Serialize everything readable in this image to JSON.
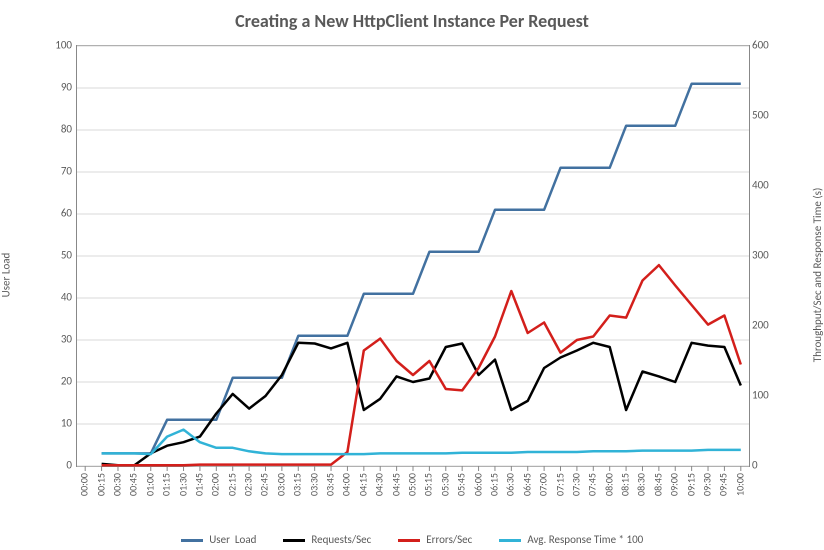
{
  "chart_data": {
    "type": "line",
    "title": "Creating a New HttpClient Instance Per Request",
    "xlabel": "",
    "ylabel_left": "User Load",
    "ylabel_right": "Throughput/Sec and Response Time (s)",
    "ylim_left": [
      0,
      100
    ],
    "ylim_right": [
      0,
      600
    ],
    "yticks_left": [
      0,
      10,
      20,
      30,
      40,
      50,
      60,
      70,
      80,
      90,
      100
    ],
    "yticks_right": [
      0,
      100,
      200,
      300,
      400,
      500,
      600
    ],
    "categories": [
      "00:00",
      "00:15",
      "00:30",
      "00:45",
      "01:00",
      "01:15",
      "01:30",
      "01:45",
      "02:00",
      "02:15",
      "02:30",
      "02:45",
      "03:00",
      "03:15",
      "03:30",
      "03:45",
      "04:00",
      "04:15",
      "04:30",
      "04:45",
      "05:00",
      "05:15",
      "05:30",
      "05:45",
      "06:00",
      "06:15",
      "06:30",
      "06:45",
      "07:00",
      "07:15",
      "07:30",
      "07:45",
      "08:00",
      "08:15",
      "08:30",
      "08:45",
      "09:00",
      "09:15",
      "09:30",
      "09:45",
      "10:00"
    ],
    "series": [
      {
        "name": "User  Load",
        "axis": "left",
        "color": "#4271A0",
        "values": [
          null,
          3,
          3,
          3,
          3,
          11,
          11,
          11,
          11,
          21,
          21,
          21,
          21,
          31,
          31,
          31,
          31,
          41,
          41,
          41,
          41,
          51,
          51,
          51,
          51,
          61,
          61,
          61,
          61,
          71,
          71,
          71,
          71,
          81,
          81,
          81,
          81,
          91,
          91,
          91,
          91
        ]
      },
      {
        "name": "Requests/Sec",
        "axis": "right",
        "color": "#000000",
        "values": [
          null,
          3,
          1,
          1,
          18,
          29,
          34,
          42,
          75,
          103,
          82,
          100,
          130,
          176,
          175,
          168,
          176,
          80,
          96,
          128,
          120,
          125,
          170,
          175,
          130,
          152,
          80,
          93,
          140,
          155,
          165,
          176,
          170,
          80,
          135,
          128,
          120,
          176,
          172,
          170,
          115
        ]
      },
      {
        "name": "Errors/Sec",
        "axis": "right",
        "color": "#D31F1B",
        "values": [
          null,
          1,
          1,
          1,
          1,
          1,
          1,
          2,
          2,
          2,
          2,
          2,
          2,
          2,
          2,
          2,
          20,
          165,
          182,
          150,
          130,
          150,
          110,
          108,
          140,
          185,
          250,
          190,
          205,
          162,
          180,
          185,
          215,
          212,
          265,
          287,
          258,
          230,
          202,
          215,
          145
        ]
      },
      {
        "name": "Avg. Response Time * 100",
        "axis": "right",
        "color": "#31B3D7",
        "values": [
          null,
          18,
          18,
          18,
          17,
          42,
          52,
          34,
          26,
          26,
          21,
          18,
          17,
          17,
          17,
          17,
          17,
          17,
          18,
          18,
          18,
          18,
          18,
          19,
          19,
          19,
          19,
          20,
          20,
          20,
          20,
          21,
          21,
          21,
          22,
          22,
          22,
          22,
          23,
          23,
          23
        ]
      }
    ],
    "legend_position": "bottom",
    "grid": {
      "y": true,
      "x": false
    }
  }
}
